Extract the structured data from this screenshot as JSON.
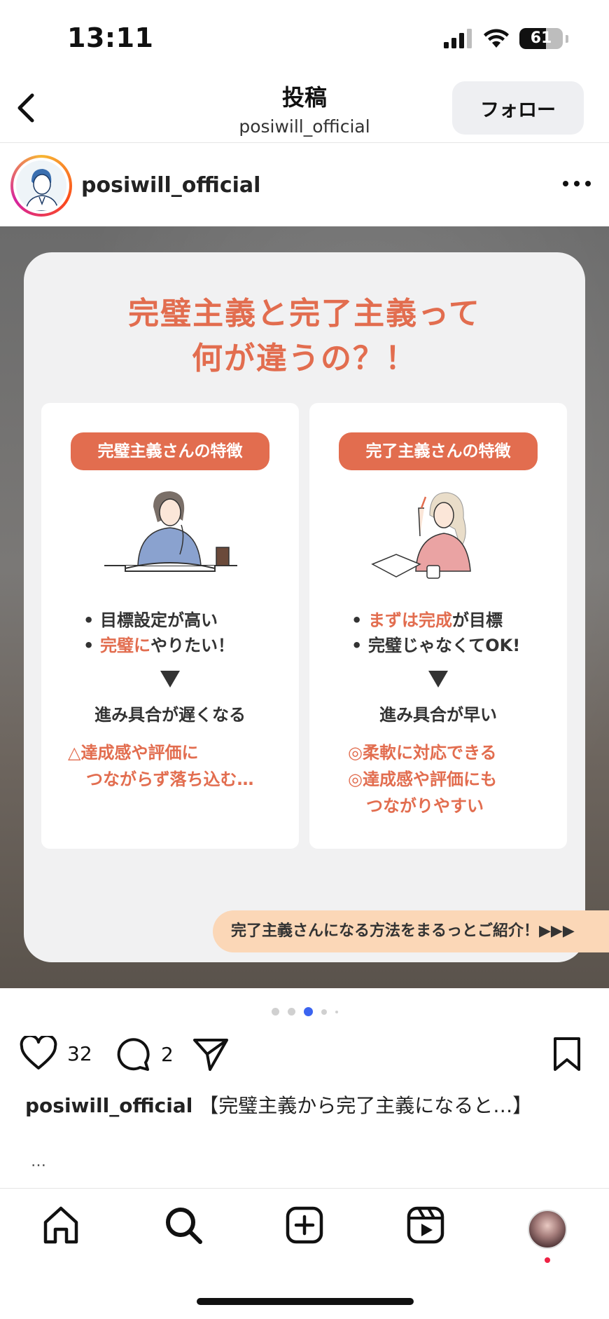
{
  "status_bar": {
    "time": "13:11",
    "battery": "61",
    "battery_level": 0.61
  },
  "header": {
    "title": "投稿",
    "subtitle": "posiwill_official",
    "follow_label": "フォロー"
  },
  "post": {
    "username": "posiwill_official"
  },
  "card": {
    "title_line1": "完璧主義と完了主義って",
    "title_line2": "何が違うの？！",
    "left": {
      "pill": "完璧主義さんの特徴",
      "bullet1": "目標設定が高い",
      "bullet2_accent": "完璧に",
      "bullet2_rest": "やりたい！",
      "result": "進み具合が遅くなる",
      "note_line1": "△達成感や評価に",
      "note_line2": "つながらず落ち込む…"
    },
    "right": {
      "pill": "完了主義さんの特徴",
      "bullet1_accent": "まずは完成",
      "bullet1_rest": "が目標",
      "bullet2": "完璧じゃなくてOK!",
      "result": "進み具合が早い",
      "note_line1": "◎柔軟に対応できる",
      "note_line2": "◎達成感や評価にも",
      "note_line3": "つながりやすい"
    },
    "banner": "完了主義さんになる方法をまるっとご紹介！▶▶▶"
  },
  "carousel": {
    "total": 5,
    "active_index": 2
  },
  "actions": {
    "likes": "32",
    "comments": "2"
  },
  "caption": {
    "username": "posiwill_official",
    "text": "【完璧主義から完了主義になると…】",
    "more": "…"
  },
  "colors": {
    "accent": "#e26d4f",
    "banner": "#fbd7b7",
    "active_dot": "#3b64f0"
  },
  "icons": [
    "back-chevron-icon",
    "signal-icon",
    "wifi-icon",
    "battery-icon",
    "more-options-icon",
    "heart-icon",
    "comment-icon",
    "share-icon",
    "bookmark-icon",
    "home-icon",
    "search-icon",
    "create-icon",
    "reels-icon",
    "profile-avatar"
  ]
}
